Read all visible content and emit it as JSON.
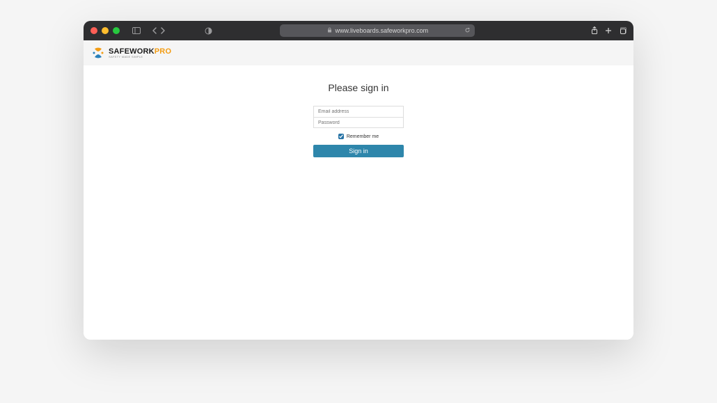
{
  "browser": {
    "url": "www.liveboards.safeworkpro.com"
  },
  "header": {
    "logo": {
      "safework": "SAFEWORK",
      "pro": "PRO",
      "tagline": "SAFETY MADE SIMPLE"
    }
  },
  "signin": {
    "title": "Please sign in",
    "email_placeholder": "Email address",
    "password_placeholder": "Password",
    "remember_label": "Remember me",
    "remember_checked": true,
    "submit_label": "Sign in"
  }
}
